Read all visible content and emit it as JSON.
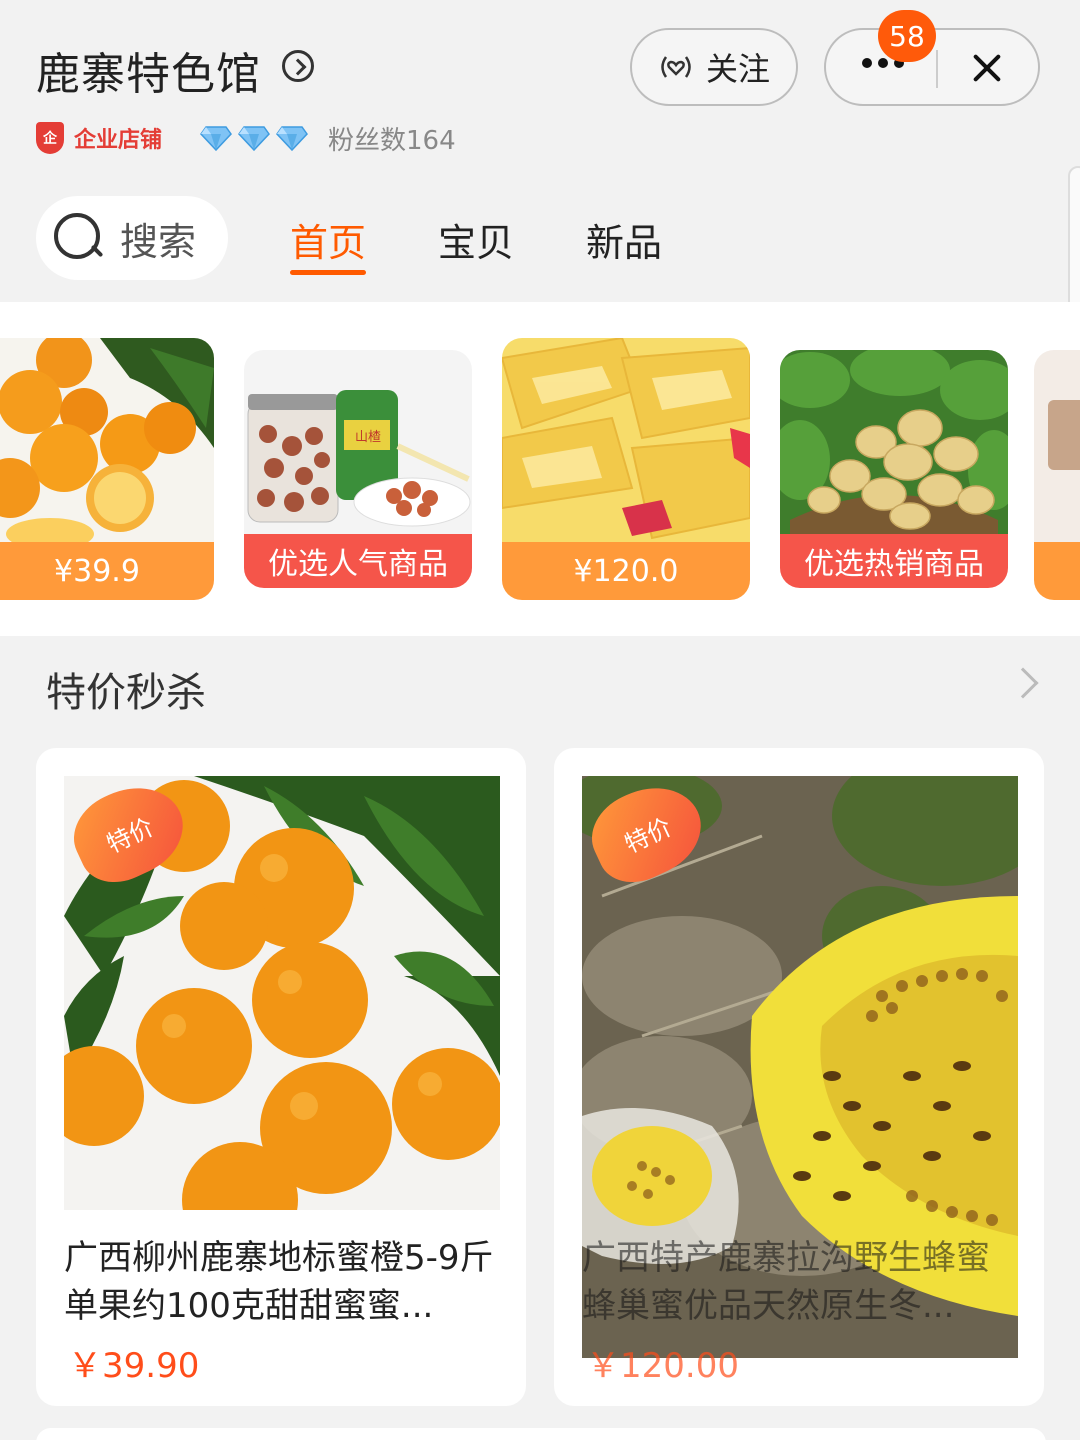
{
  "shop": {
    "name": "鹿寨特色馆",
    "type_label": "企业店铺",
    "shield_char": "企",
    "fans": "粉丝数164",
    "diamonds": 3
  },
  "actions": {
    "follow_label": "关注",
    "notification_count": "58"
  },
  "search": {
    "label": "搜索"
  },
  "tabs": [
    {
      "label": "首页",
      "active": true
    },
    {
      "label": "宝贝",
      "active": false
    },
    {
      "label": "新品",
      "active": false
    }
  ],
  "carousel": [
    {
      "band": "¥39.9",
      "band_color": "#ff9a3a",
      "image": "oranges"
    },
    {
      "band": "优选人气商品",
      "band_color": "#f5554a",
      "image": "hawthorn-jars"
    },
    {
      "band": "¥120.0",
      "band_color": "#ff9a3a",
      "image": "honeycomb"
    },
    {
      "band": "优选热销商品",
      "band_color": "#f5554a",
      "image": "potatoes"
    }
  ],
  "section": {
    "title": "特价秒杀"
  },
  "products": [
    {
      "tag": "特价",
      "title": "广西柳州鹿寨地标蜜橙5-9斤单果约100克甜甜蜜蜜...",
      "price": "￥39.90",
      "image": "oranges"
    },
    {
      "tag": "特价",
      "title": "广西特产鹿寨拉沟野生蜂蜜蜂巢蜜优品天然原生冬...",
      "price": "￥120.00",
      "image": "wild-honeycomb-bees"
    }
  ],
  "colors": {
    "accent": "#ff5a00",
    "price": "#ff4d1a",
    "band_orange": "#ff9a3a",
    "band_red": "#f5554a",
    "enterprise_red": "#e43d36"
  }
}
